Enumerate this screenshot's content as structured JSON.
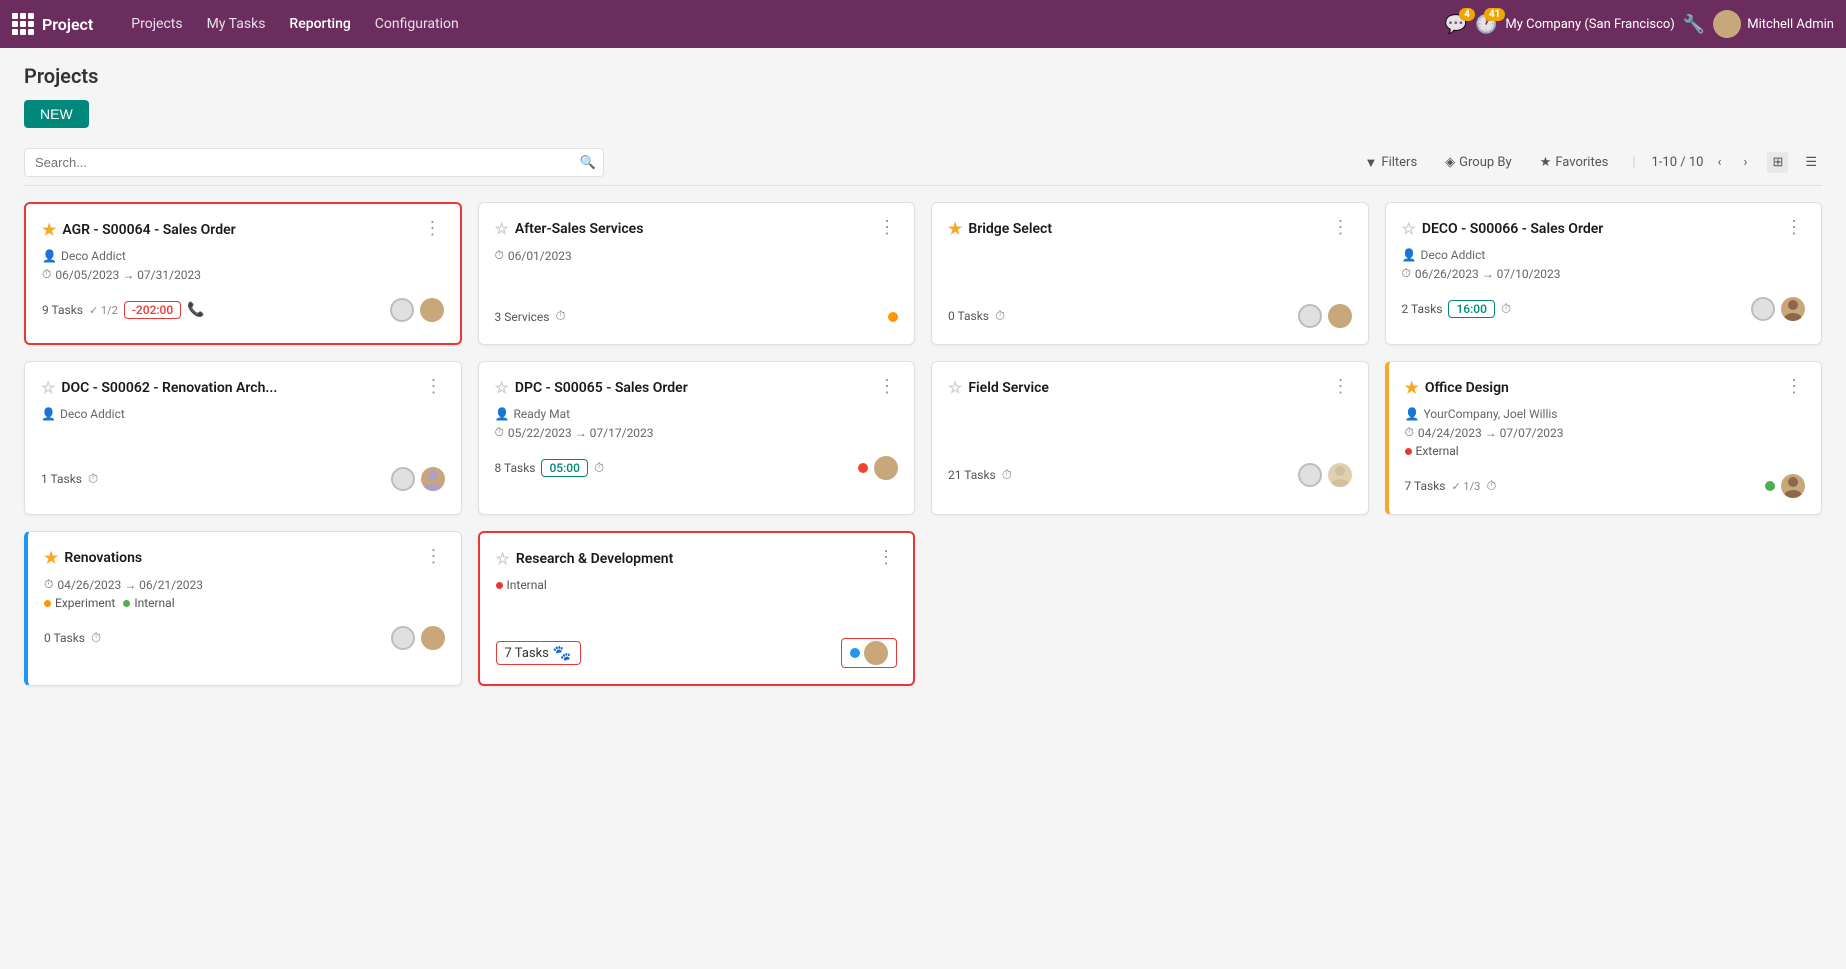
{
  "app": {
    "logo_app": "Project",
    "nav_items": [
      "Projects",
      "My Tasks",
      "Reporting",
      "Configuration"
    ],
    "active_nav": "Reporting",
    "company": "My Company (San Francisco)",
    "user": "Mitchell Admin",
    "badge_chat": "4",
    "badge_clock": "41"
  },
  "page": {
    "title": "Projects",
    "new_btn": "NEW"
  },
  "toolbar": {
    "search_placeholder": "Search...",
    "filters_label": "Filters",
    "groupby_label": "Group By",
    "favorites_label": "Favorites",
    "pagination": "1-10 / 10"
  },
  "projects": [
    {
      "id": "agr",
      "title": "AGR - S00064 - Sales Order",
      "starred": true,
      "client": "Deco Addict",
      "date_range": "06/05/2023 → 07/31/2023",
      "tasks_count": "9 Tasks",
      "tasks_check": "1/2",
      "badge": "-202:00",
      "badge_type": "red",
      "has_phone": true,
      "status_dot": "grey",
      "has_avatar": true,
      "border": "red",
      "tags": []
    },
    {
      "id": "after-sales",
      "title": "After-Sales Services",
      "starred": false,
      "client": "",
      "date_range": "06/01/2023",
      "tasks_count": "3 Services",
      "badge": "",
      "badge_type": "",
      "has_phone": false,
      "status_dot": "orange",
      "has_avatar": false,
      "border": "none",
      "tags": []
    },
    {
      "id": "bridge-select",
      "title": "Bridge Select",
      "starred": true,
      "client": "",
      "date_range": "",
      "tasks_count": "0 Tasks",
      "badge": "",
      "badge_type": "",
      "has_phone": false,
      "status_dot": "grey",
      "has_avatar": true,
      "border": "none",
      "tags": [],
      "subtitle": "Tasks"
    },
    {
      "id": "deco",
      "title": "DECO - S00066 - Sales Order",
      "starred": false,
      "client": "Deco Addict",
      "date_range": "06/26/2023 → 07/10/2023",
      "tasks_count": "2 Tasks",
      "badge": "16:00",
      "badge_type": "teal",
      "has_phone": false,
      "status_dot": "grey",
      "has_avatar": true,
      "border": "none",
      "tags": []
    },
    {
      "id": "doc-renovation",
      "title": "DOC - S00062 - Renovation Arch...",
      "starred": false,
      "client": "Deco Addict",
      "date_range": "",
      "tasks_count": "1 Tasks",
      "badge": "",
      "badge_type": "",
      "has_phone": false,
      "status_dot": "grey",
      "has_avatar": true,
      "border": "none",
      "tags": []
    },
    {
      "id": "dpc-sales",
      "title": "DPC - S00065 - Sales Order",
      "starred": false,
      "client": "Ready Mat",
      "date_range": "05/22/2023 → 07/17/2023",
      "tasks_count": "8 Tasks",
      "badge": "05:00",
      "badge_type": "teal",
      "has_phone": false,
      "status_dot": "red",
      "has_avatar": true,
      "border": "none",
      "tags": []
    },
    {
      "id": "field-service",
      "title": "Field Service",
      "starred": false,
      "client": "",
      "date_range": "",
      "tasks_count": "21 Tasks",
      "badge": "",
      "badge_type": "",
      "has_phone": false,
      "status_dot": "grey",
      "has_avatar": true,
      "border": "none",
      "tags": [],
      "subtitle": "Tasks"
    },
    {
      "id": "office-design",
      "title": "Office Design",
      "starred": true,
      "client": "YourCompany, Joel Willis",
      "date_range": "04/24/2023 → 07/07/2023",
      "tasks_count": "7 Tasks",
      "tasks_check": "1/3",
      "badge": "",
      "badge_type": "",
      "has_phone": false,
      "status_dot": "green",
      "has_avatar": true,
      "border": "yellow-left",
      "tags": [
        "External"
      ],
      "tag_color": "red-dot"
    },
    {
      "id": "renovations",
      "title": "Renovations",
      "starred": true,
      "client": "",
      "date_range": "04/26/2023 → 06/21/2023",
      "tasks_count": "0 Tasks",
      "badge": "",
      "badge_type": "",
      "has_phone": false,
      "status_dot": "grey",
      "has_avatar": true,
      "border": "blue-left",
      "tags": [
        "Experiment",
        "Internal"
      ]
    },
    {
      "id": "research-dev",
      "title": "Research & Development",
      "starred": false,
      "client": "",
      "date_range": "",
      "tasks_count": "7 Tasks",
      "badge": "",
      "badge_type": "",
      "has_phone": false,
      "status_dot": "blue",
      "has_avatar": true,
      "border": "red",
      "tags": [
        "Internal"
      ],
      "tag_color": "red-dot"
    }
  ]
}
